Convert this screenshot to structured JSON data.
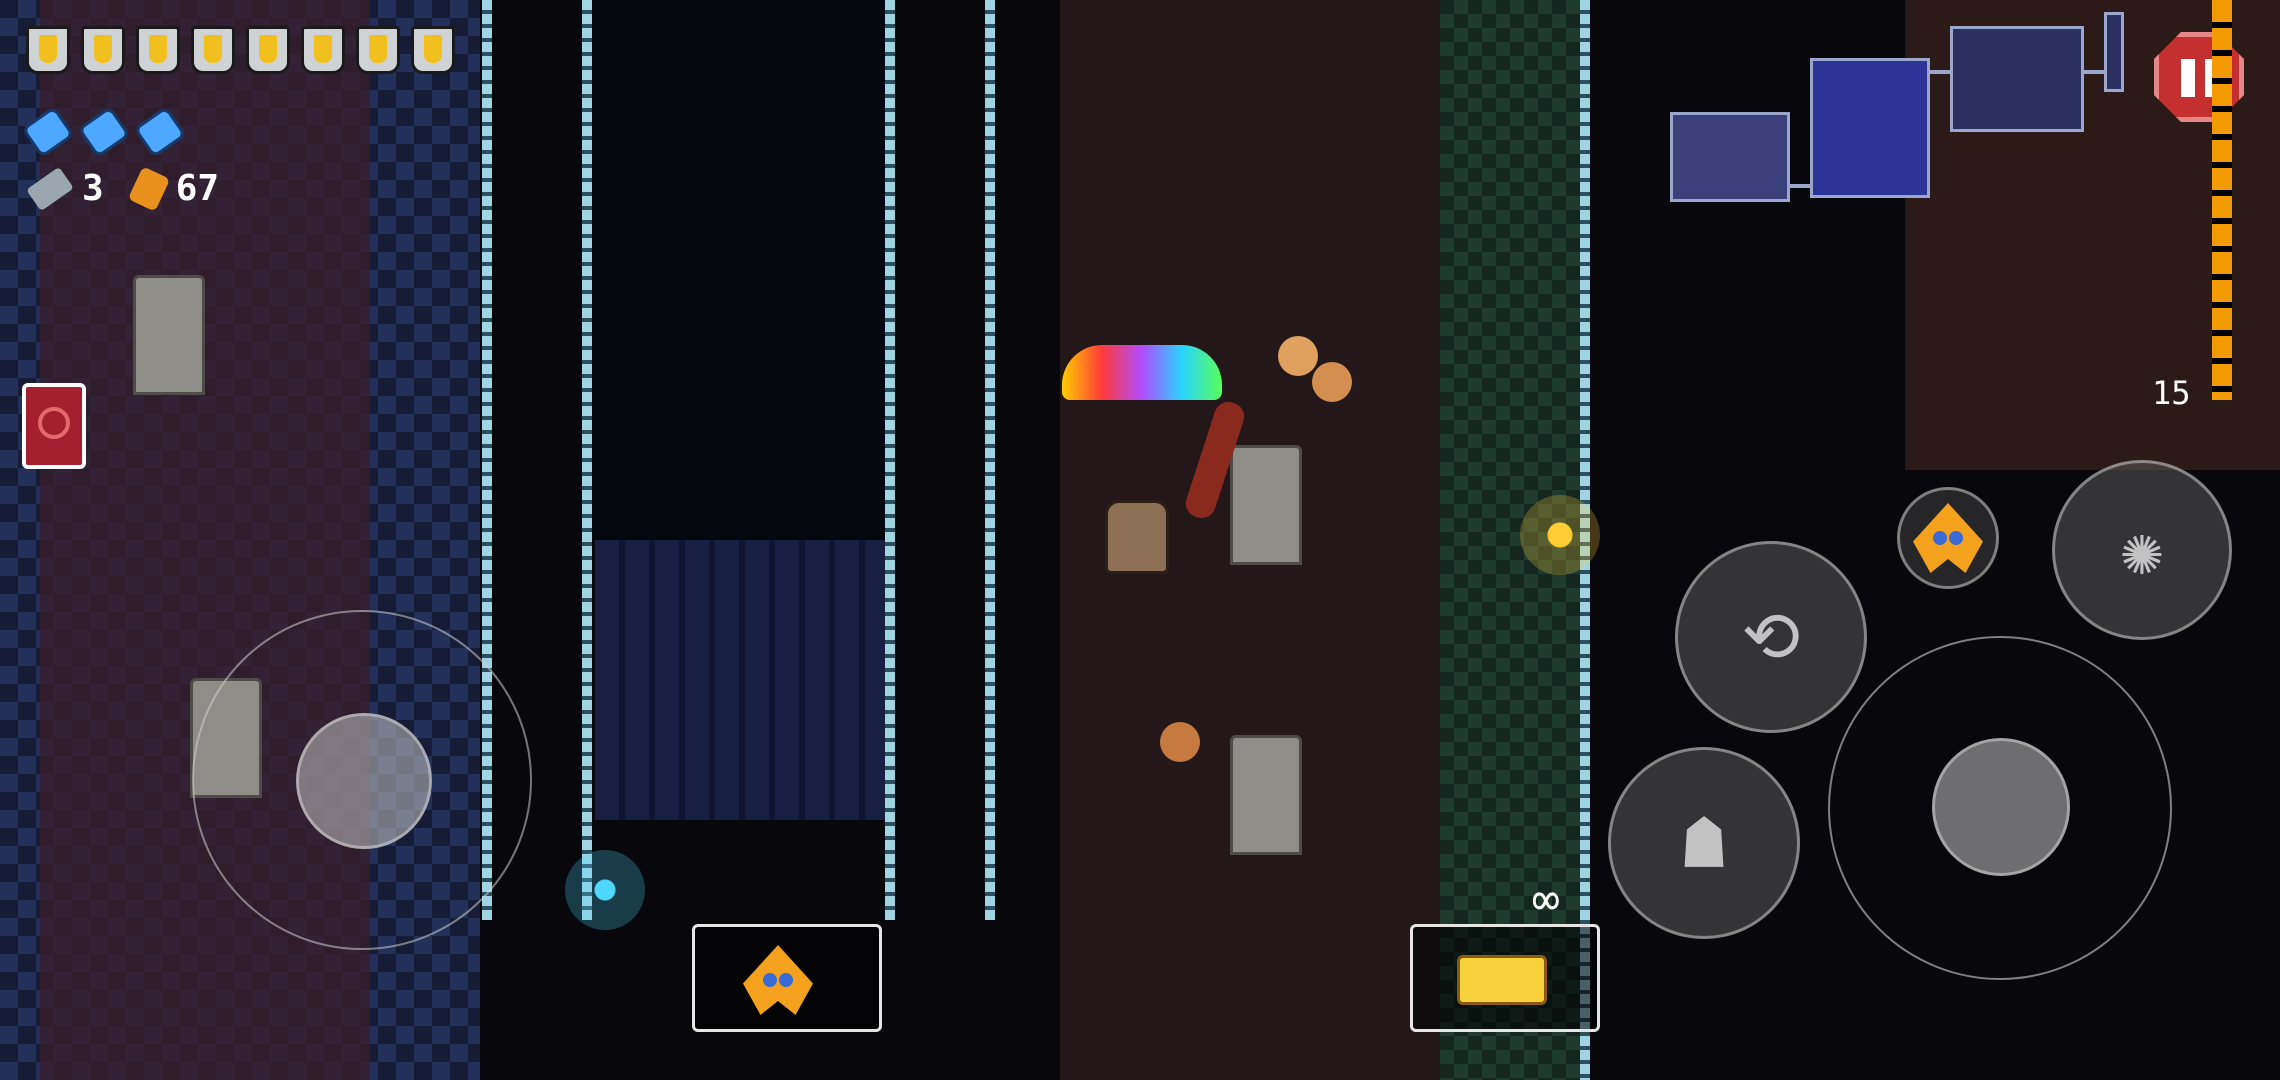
{
  "hud": {
    "armor_count": 8,
    "blanks_count": 3,
    "keys": "3",
    "shells": "67"
  },
  "boss_floor_number": "15",
  "ammo_display": "∞",
  "icons": {
    "armor": "armor-shield-icon",
    "blank": "blank-icon",
    "key": "key-icon",
    "shell": "shell-currency-icon",
    "active_item": "book-item-icon",
    "pause": "pause-icon",
    "dodge_roll": "dodge-roll-icon",
    "interact": "ghost-interact-icon",
    "reload": "reload-icon",
    "weapon": "cheese-gun-icon",
    "companion": "guon-star-icon"
  },
  "colors": {
    "pause_red": "#c42f2f",
    "boss_bar": "#f39a00",
    "minimap_room": "#2d3498"
  }
}
